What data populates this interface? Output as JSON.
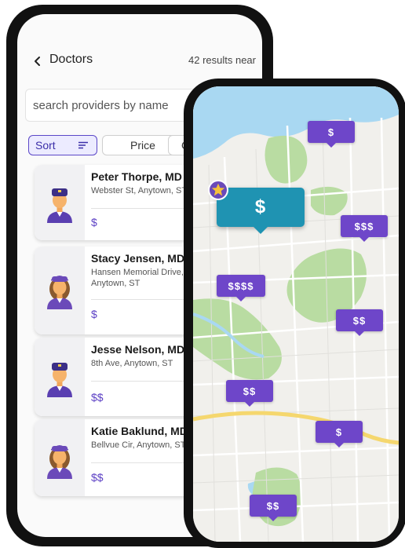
{
  "header": {
    "back_label": "Doctors",
    "results_text": "42 results near"
  },
  "search": {
    "placeholder": "search providers by name"
  },
  "filters": {
    "sort_label": "Sort",
    "price_label": "Price",
    "gender_label": "Ge"
  },
  "doctors": [
    {
      "name": "Peter Thorpe, MD",
      "address": "Webster St, Anytown, ST",
      "price": "$",
      "avatar": "male-doctor-icon"
    },
    {
      "name": "Stacy Jensen, MD",
      "address": "Hansen Memorial Drive, Anytown, ST",
      "price": "$",
      "avatar": "female-doctor-icon"
    },
    {
      "name": "Jesse Nelson, MD",
      "address": "8th Ave, Anytown, ST",
      "price": "$$",
      "avatar": "male-doctor-icon"
    },
    {
      "name": "Katie Baklund, MD",
      "address": "Bellvue Cir, Anytown, ST",
      "price": "$$",
      "avatar": "female-doctor-icon"
    }
  ],
  "map": {
    "selected_pin": "$",
    "pins": [
      "$",
      "$$$",
      "$$$$",
      "$$",
      "$$",
      "$",
      "$$"
    ],
    "favorite_icon": "star-icon"
  },
  "colors": {
    "accent": "#5b47c8",
    "pin": "#6e46c9",
    "selected_pin": "#1f93b2",
    "water": "#a9d8f2",
    "park": "#b9dca2",
    "highway": "#f5d76e"
  }
}
